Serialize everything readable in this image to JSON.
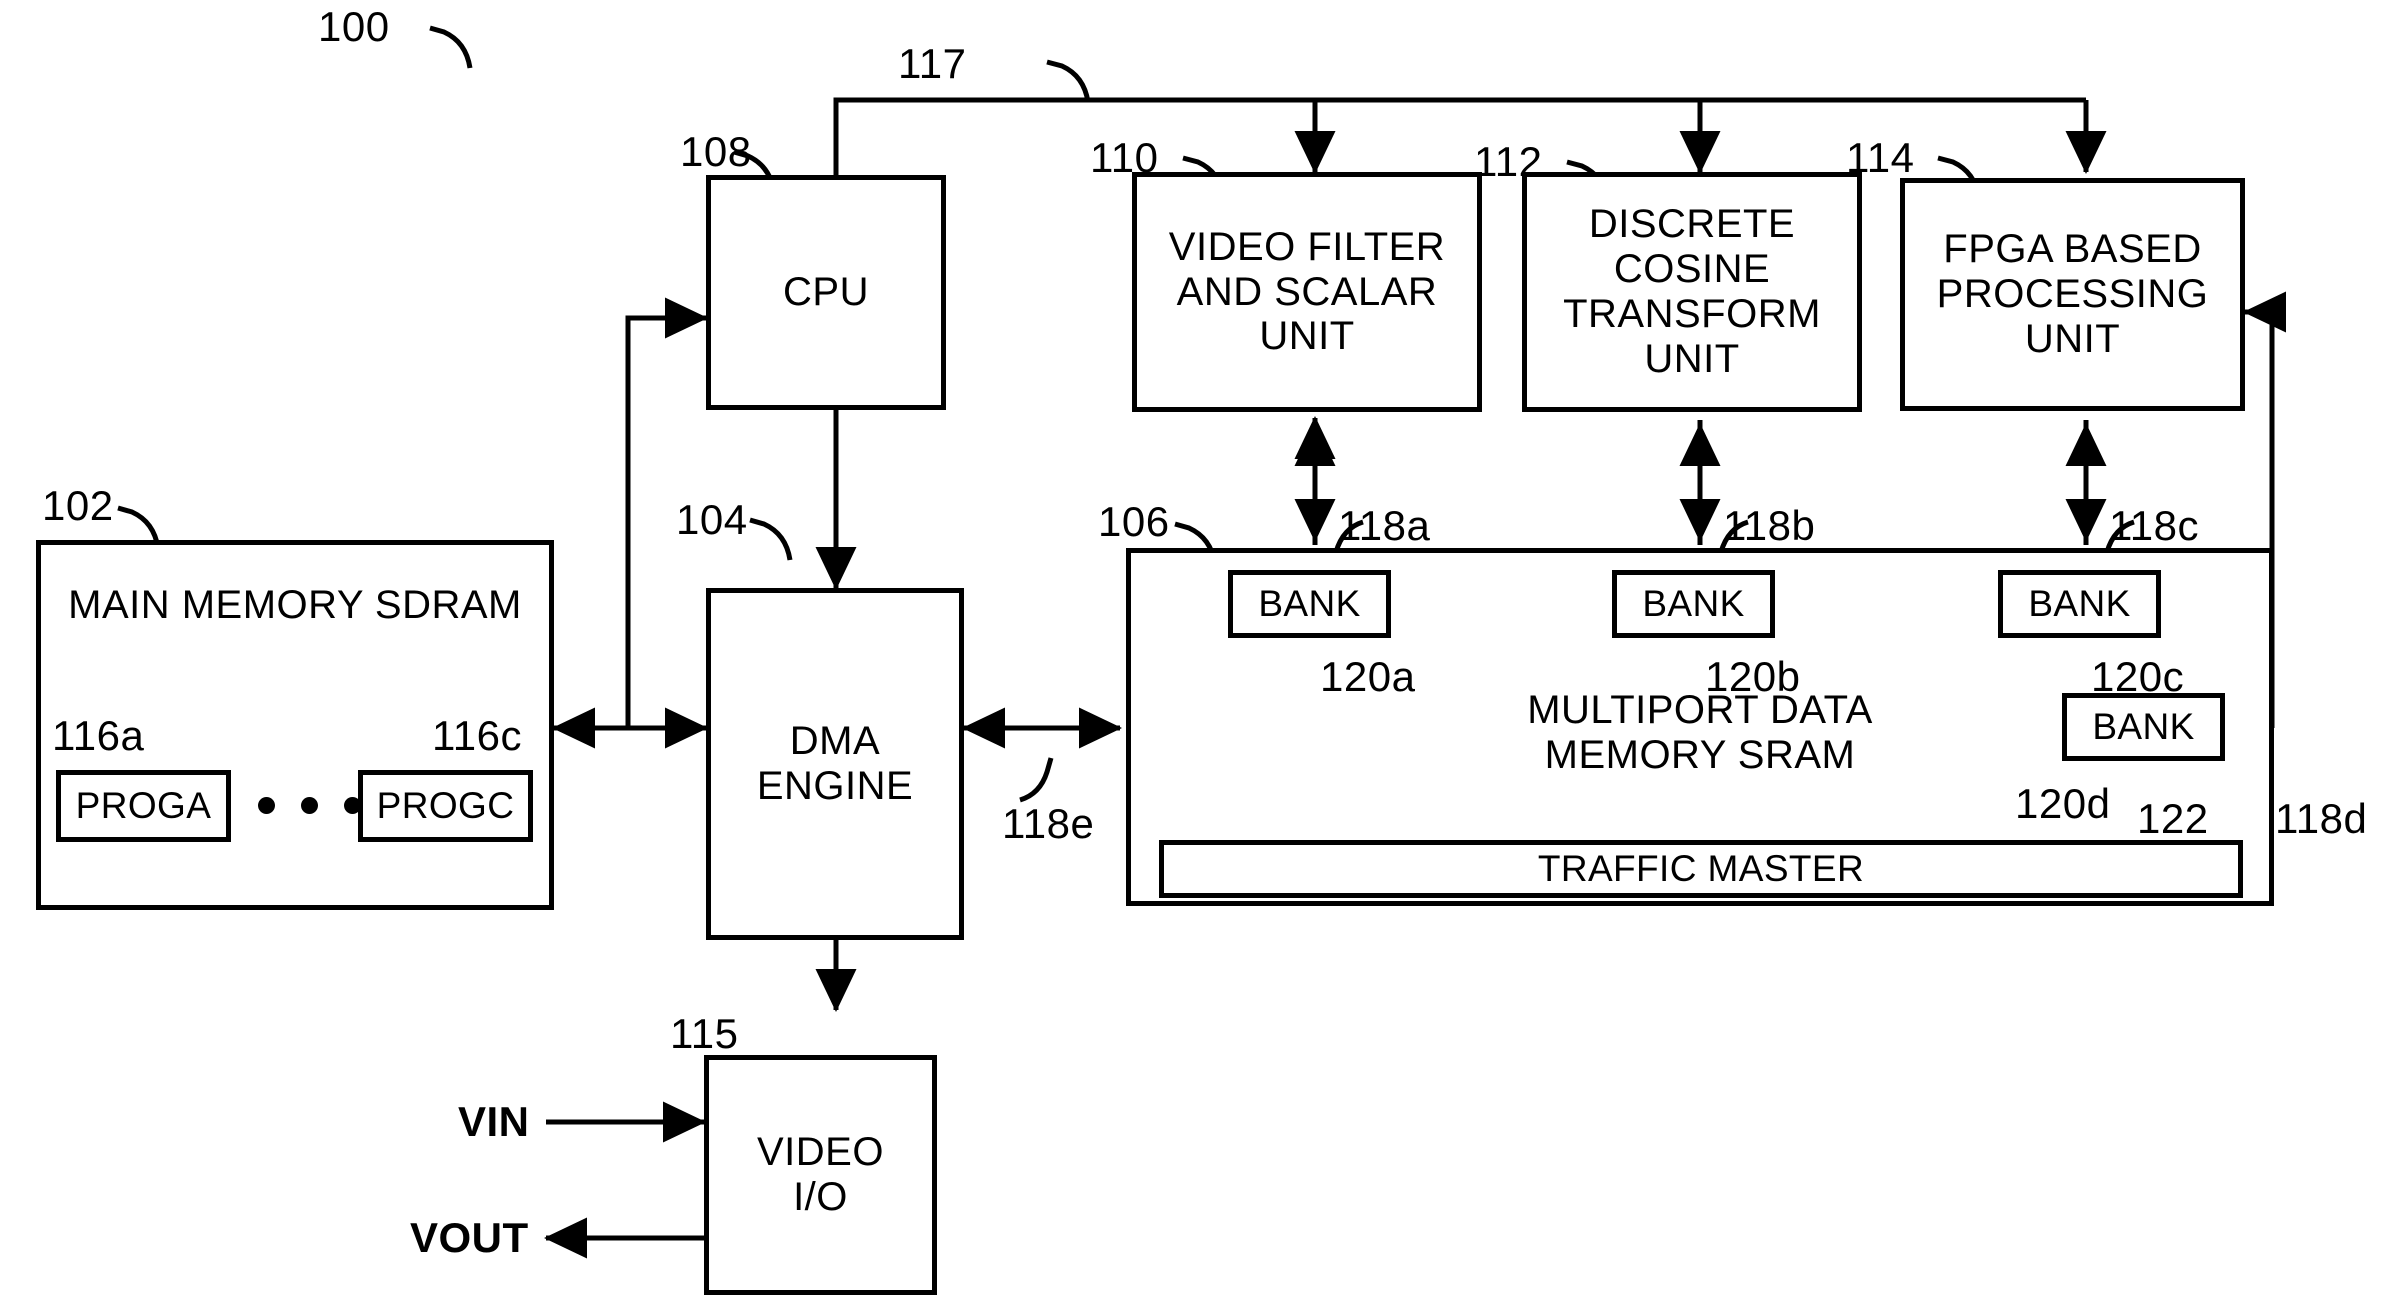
{
  "figure": {
    "title_ref": "100",
    "bus_ref": "117"
  },
  "blocks": {
    "cpu": {
      "ref": "108",
      "label": "CPU"
    },
    "video_filter": {
      "ref": "110",
      "label": "VIDEO FILTER\nAND SCALAR\nUNIT"
    },
    "dct": {
      "ref": "112",
      "label": "DISCRETE\nCOSINE\nTRANSFORM\nUNIT"
    },
    "fpga": {
      "ref": "114",
      "label": "FPGA BASED\nPROCESSING\nUNIT"
    },
    "main_memory": {
      "ref": "102",
      "label": "MAIN MEMORY SDRAM"
    },
    "dma": {
      "ref": "104",
      "label": "DMA\nENGINE"
    },
    "sram": {
      "ref": "106",
      "label": "MULTIPORT DATA\nMEMORY SRAM"
    },
    "video_io": {
      "ref": "115",
      "label": "VIDEO\nI/O"
    }
  },
  "programs": [
    {
      "ref": "116a",
      "label": "PROGA"
    },
    {
      "ref": "116c",
      "label": "PROGC"
    }
  ],
  "banks": [
    {
      "ref": "120a",
      "label": "BANK"
    },
    {
      "ref": "120b",
      "label": "BANK"
    },
    {
      "ref": "120c",
      "label": "BANK"
    },
    {
      "ref": "120d",
      "label": "BANK"
    }
  ],
  "traffic_master": {
    "ref": "122",
    "label": "TRAFFIC MASTER"
  },
  "port_refs": {
    "p118a": "118a",
    "p118b": "118b",
    "p118c": "118c",
    "p118d": "118d",
    "p118e": "118e"
  },
  "signals": {
    "vin": "VIN",
    "vout": "VOUT"
  },
  "colors": {
    "ink": "#000000",
    "paper": "#ffffff"
  }
}
